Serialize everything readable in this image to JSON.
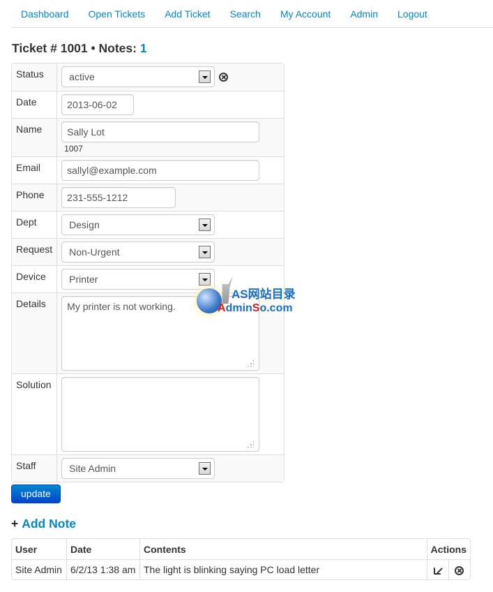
{
  "nav": {
    "items": [
      "Dashboard",
      "Open Tickets",
      "Add Ticket",
      "Search",
      "My Account",
      "Admin",
      "Logout"
    ]
  },
  "ticket": {
    "title_prefix": "Ticket # 1001 • Notes: ",
    "notes_count": "1"
  },
  "form": {
    "status": {
      "label": "Status",
      "value": "active"
    },
    "date": {
      "label": "Date",
      "value": "2013-06-02"
    },
    "name": {
      "label": "Name",
      "value": "Sally Lot",
      "user_id": "1007"
    },
    "email": {
      "label": "Email",
      "value": "sallyl@example.com"
    },
    "phone": {
      "label": "Phone",
      "value": "231-555-1212"
    },
    "dept": {
      "label": "Dept",
      "value": "Design"
    },
    "request": {
      "label": "Request",
      "value": "Non-Urgent"
    },
    "device": {
      "label": "Device",
      "value": "Printer"
    },
    "details": {
      "label": "Details",
      "value": "My printer is not working."
    },
    "solution": {
      "label": "Solution",
      "value": ""
    },
    "staff": {
      "label": "Staff",
      "value": "Site Admin"
    }
  },
  "update_button": "update",
  "add_note": {
    "plus": "+",
    "label": "Add Note"
  },
  "notes_table": {
    "headers": [
      "User",
      "Date",
      "Contents",
      "Actions"
    ],
    "rows": [
      {
        "user": "Site Admin",
        "date": "6/2/13 1:38 am",
        "contents": "The light is blinking saying PC load letter"
      }
    ]
  },
  "watermark": {
    "cn": "AS网站目录",
    "en_a": "A",
    "en_dmin": "dmin",
    "en_s": "S",
    "en_rest": "o.com"
  },
  "colors": {
    "link": "#0088cc",
    "button": "#0055cc",
    "border": "#dddddd"
  }
}
